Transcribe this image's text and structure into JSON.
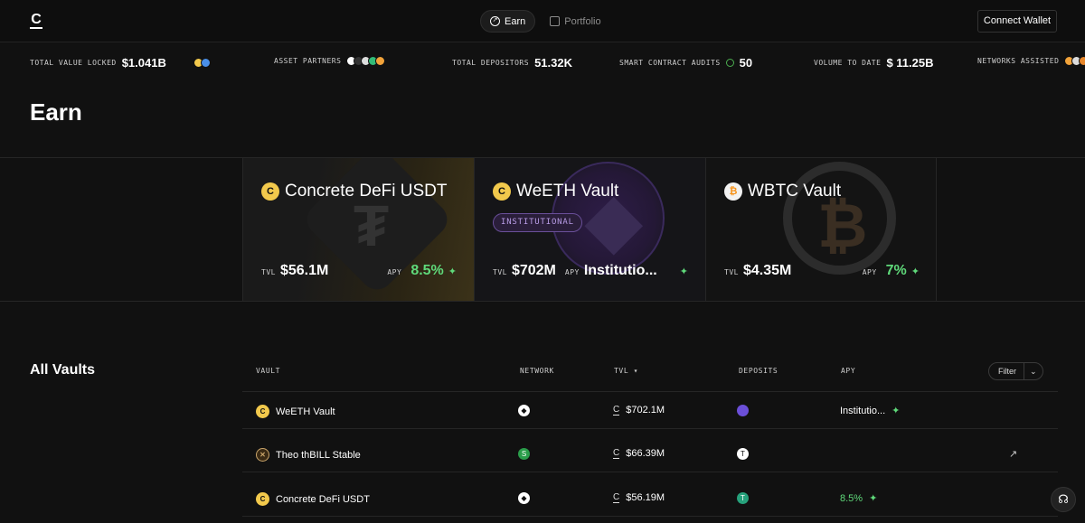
{
  "nav": {
    "logo": "C",
    "tabs": [
      {
        "label": "Earn",
        "icon": "earn-icon"
      },
      {
        "label": "Portfolio",
        "icon": "portfolio-icon"
      }
    ],
    "connect_label": "Connect Wallet"
  },
  "stats": {
    "tvl_label": "TOTAL VALUE LOCKED",
    "tvl_value": "$1.041B",
    "partners_label": "ASSET PARTNERS",
    "depositors_label": "TOTAL DEPOSITORS",
    "depositors_value": "51.32K",
    "audits_label": "SMART CONTRACT AUDITS",
    "audits_value": "50",
    "volume_label": "VOLUME TO DATE",
    "volume_value": "$ 11.25B",
    "networks_label": "NETWORKS ASSISTED"
  },
  "page_title": "Earn",
  "featured": [
    {
      "title": "Concrete DeFi USDT",
      "tvl_key": "TVL",
      "tvl": "$56.1M",
      "apy_key": "APY",
      "apy": "8.5%"
    },
    {
      "title": "WeETH Vault",
      "badge": "INSTITUTIONAL",
      "tvl_key": "TVL",
      "tvl": "$702M",
      "apy_key": "APY",
      "apy": "Institutio..."
    },
    {
      "title": "WBTC Vault",
      "tvl_key": "TVL",
      "tvl": "$4.35M",
      "apy_key": "APY",
      "apy": "7%"
    }
  ],
  "vaults": {
    "title": "All Vaults",
    "headers": {
      "vault": "VAULT",
      "network": "NETWORK",
      "tvl": "TVL ▾",
      "deposits": "DEPOSITS",
      "apy": "APY"
    },
    "filter_label": "Filter",
    "rows": [
      {
        "name": "WeETH Vault",
        "tvl": "$702.1M",
        "apy": "Institutio..."
      },
      {
        "name": "Theo thBILL Stable",
        "tvl": "$66.39M",
        "apy": ""
      },
      {
        "name": "Concrete DeFi USDT",
        "tvl": "$56.19M",
        "apy": "8.5%"
      }
    ]
  },
  "colors": {
    "accent_green": "#5fd97a",
    "gold": "#f2c94c",
    "badge_purple": "#b89ce6"
  }
}
